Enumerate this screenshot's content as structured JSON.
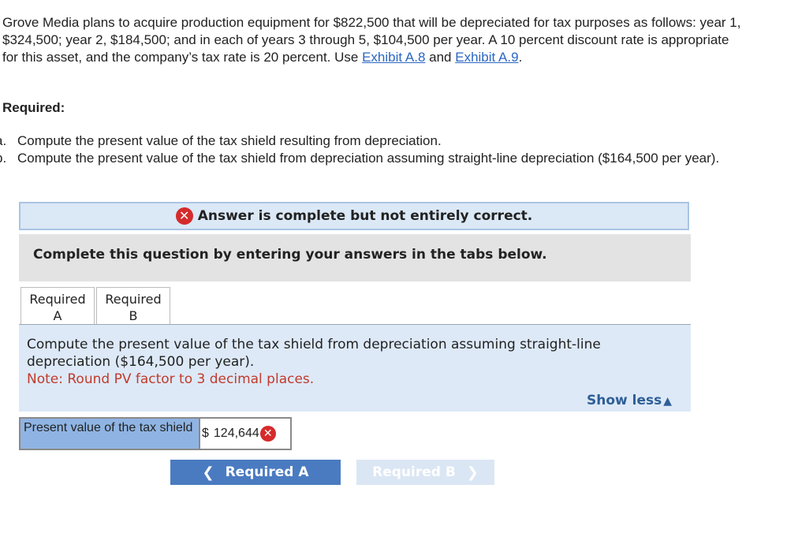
{
  "problem": {
    "text_before_link1": "Grove Media plans to acquire production equipment for $822,500 that will be depreciated for tax purposes as follows: year 1, $324,500; year 2, $184,500; and in each of years 3 through 5, $104,500 per year. A 10 percent discount rate is appropriate for this asset, and the company’s tax rate is 20 percent. Use ",
    "link1": "Exhibit A.8",
    "between_links": " and ",
    "link2": "Exhibit A.9",
    "after_link2": "."
  },
  "required_heading": "Required:",
  "requirements": [
    {
      "letter": "a.",
      "text": "Compute the present value of the tax shield resulting from depreciation."
    },
    {
      "letter": "b.",
      "text": "Compute the present value of the tax shield from depreciation assuming straight-line depreciation ($164,500 per year)."
    }
  ],
  "banner": {
    "icon": "x-circle-icon",
    "text": "Answer is complete but not entirely correct."
  },
  "instruction": "Complete this question by entering your answers in the tabs below.",
  "tabs": [
    {
      "line1": "Required",
      "line2": "A"
    },
    {
      "line1": "Required",
      "line2": "B"
    }
  ],
  "active_tab": 1,
  "question": {
    "text": "Compute the present value of the tax shield from depreciation assuming straight-line depreciation ($164,500 per year).",
    "note": "Note: Round PV factor to 3 decimal places.",
    "show_less": "Show less"
  },
  "answer": {
    "label": "Present value of the tax shield",
    "currency": "$",
    "value": "124,644",
    "status": "incorrect"
  },
  "nav": {
    "prev_label": "Required A",
    "next_label": "Required B"
  },
  "colors": {
    "link": "#2b66c2",
    "error": "#d52b2b",
    "note": "#c23a2b",
    "primary_button": "#4a7bc1"
  }
}
